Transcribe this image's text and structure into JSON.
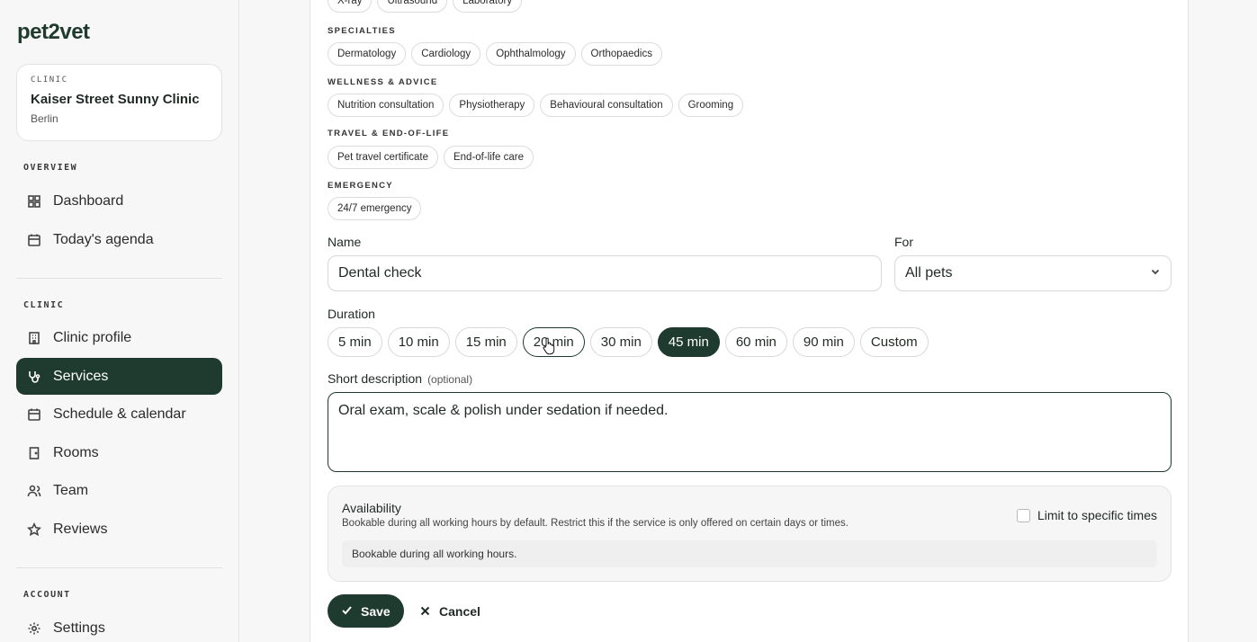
{
  "brand": {
    "logo_pre": "pet",
    "logo_two": "2",
    "logo_post": "vet"
  },
  "clinic_card": {
    "kicker": "CLINIC",
    "name": "Kaiser Street Sunny Clinic",
    "city": "Berlin"
  },
  "sidebar": {
    "overview_label": "OVERVIEW",
    "overview_items": [
      {
        "label": "Dashboard",
        "icon": "grid-icon"
      },
      {
        "label": "Today's agenda",
        "icon": "calendar-icon"
      }
    ],
    "clinic_label": "CLINIC",
    "clinic_items": [
      {
        "label": "Clinic profile",
        "icon": "building-icon"
      },
      {
        "label": "Services",
        "icon": "stethoscope-icon",
        "active": true
      },
      {
        "label": "Schedule & calendar",
        "icon": "calendar-icon"
      },
      {
        "label": "Rooms",
        "icon": "door-icon"
      },
      {
        "label": "Team",
        "icon": "users-icon"
      },
      {
        "label": "Reviews",
        "icon": "star-icon"
      }
    ],
    "account_label": "ACCOUNT",
    "account_items": [
      {
        "label": "Settings",
        "icon": "gear-icon"
      }
    ]
  },
  "categories": {
    "top_row": [
      "X-ray",
      "Ultrasound",
      "Laboratory"
    ],
    "specialties": {
      "label": "SPECIALTIES",
      "chips": [
        "Dermatology",
        "Cardiology",
        "Ophthalmology",
        "Orthopaedics"
      ]
    },
    "wellness": {
      "label": "WELLNESS & ADVICE",
      "chips": [
        "Nutrition consultation",
        "Physiotherapy",
        "Behavioural consultation",
        "Grooming"
      ]
    },
    "travel": {
      "label": "TRAVEL & END-OF-LIFE",
      "chips": [
        "Pet travel certificate",
        "End-of-life care"
      ]
    },
    "emergency": {
      "label": "EMERGENCY",
      "chips": [
        "24/7 emergency"
      ]
    }
  },
  "form": {
    "name_label": "Name",
    "name_value": "Dental check",
    "for_label": "For",
    "for_value": "All pets",
    "duration_label": "Duration",
    "durations": [
      "5 min",
      "10 min",
      "15 min",
      "20 min",
      "30 min",
      "45 min",
      "60 min",
      "90 min",
      "Custom"
    ],
    "selected_duration": "45 min",
    "desc_label": "Short description",
    "desc_optional": "(optional)",
    "desc_value": "Oral exam, scale & polish under sedation if needed.",
    "availability_title": "Availability",
    "availability_desc": "Bookable during all working hours by default. Restrict this if the service is only offered on certain days or times.",
    "limit_label": "Limit to specific times",
    "limit_checked": false,
    "availability_note": "Bookable during all working hours.",
    "save_label": "Save",
    "cancel_label": "Cancel"
  },
  "colors": {
    "brand": "#1f3a2e",
    "background": "#f7f7f7",
    "panel": "#ffffff"
  }
}
